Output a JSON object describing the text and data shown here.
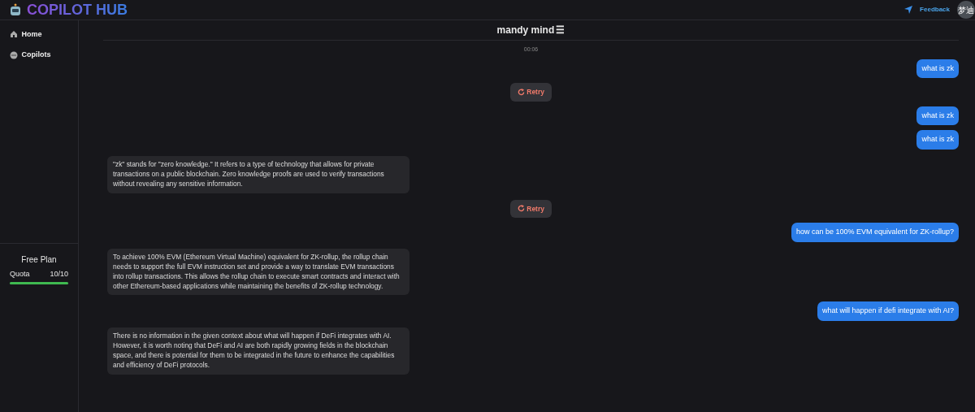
{
  "app": {
    "title": "COPILOT HUB"
  },
  "header": {
    "feedback": "Feedback",
    "avatar": "梦迪"
  },
  "sidebar": {
    "items": [
      {
        "label": "Home"
      },
      {
        "label": "Copilots"
      }
    ],
    "plan": {
      "title": "Free Plan",
      "quota_label": "Quota",
      "quota_value": "10/10",
      "level": 1.0
    }
  },
  "chat": {
    "title": "mandy mind",
    "title_icon": "☰",
    "messages": [
      {
        "kind": "time",
        "text": "00:06"
      },
      {
        "kind": "user",
        "text": "what is zk"
      },
      {
        "kind": "retry",
        "text": "Retry"
      },
      {
        "kind": "user",
        "text": "what is zk"
      },
      {
        "kind": "user",
        "text": "what is zk"
      },
      {
        "kind": "bot",
        "text": "\"zk\" stands for \"zero knowledge.\" It refers to a type of technology that allows for private transactions on a public blockchain. Zero knowledge proofs are used to verify transactions without revealing any sensitive information."
      },
      {
        "kind": "retry",
        "text": "Retry"
      },
      {
        "kind": "user",
        "text": "how can be 100% EVM equivalent for ZK-rollup?"
      },
      {
        "kind": "bot",
        "text": "To achieve 100% EVM (Ethereum Virtual Machine) equivalent for ZK-rollup, the rollup chain needs to support the full EVM instruction set and provide a way to translate EVM transactions into rollup transactions. This allows the rollup chain to execute smart contracts and interact with other Ethereum-based applications while maintaining the benefits of ZK-rollup technology."
      },
      {
        "kind": "user",
        "text": "what will happen if defi integrate with AI?"
      },
      {
        "kind": "bot",
        "text": "There is no information in the given context about what will happen if DeFi integrates with AI. However, it is worth noting that DeFi and AI are both rapidly growing fields in the blockchain space, and there is potential for them to be integrated in the future to enhance the capabilities and efficiency of DeFi protocols."
      }
    ]
  }
}
